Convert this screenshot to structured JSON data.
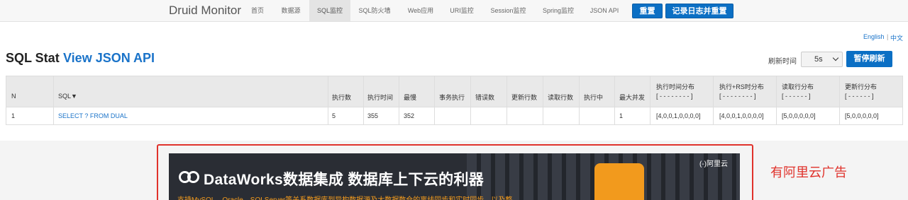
{
  "navbar": {
    "brand": "Druid Monitor",
    "items": [
      {
        "label": "首页",
        "active": false
      },
      {
        "label": "数据源",
        "active": false
      },
      {
        "label": "SQL监控",
        "active": true
      },
      {
        "label": "SQL防火墙",
        "active": false
      },
      {
        "label": "Web应用",
        "active": false
      },
      {
        "label": "URI监控",
        "active": false
      },
      {
        "label": "Session监控",
        "active": false
      },
      {
        "label": "Spring监控",
        "active": false
      },
      {
        "label": "JSON API",
        "active": false
      }
    ],
    "reset_button": "重置",
    "log_reset_button": "记录日志并重置"
  },
  "language": {
    "english": "English",
    "separator": "|",
    "chinese": "中文"
  },
  "heading": {
    "title": "SQL Stat",
    "json_link": "View JSON API"
  },
  "refresh": {
    "label": "刷新时间",
    "selected": "5s",
    "pause_button": "暂停刷新"
  },
  "table": {
    "headers": {
      "n": "N",
      "sql": "SQL▼",
      "exec_count": "执行数",
      "exec_time": "执行时间",
      "slowest": "最慢",
      "txn_exec": "事务执行",
      "errors": "错误数",
      "update_rows": "更新行数",
      "read_rows": "读取行数",
      "running": "执行中",
      "max_concurrent": "最大并发",
      "exec_time_dist": "执行时间分布",
      "exec_time_dist_sub": "[ - - - - - - - - ]",
      "exec_rs_dist": "执行+RS时分布",
      "exec_rs_dist_sub": "[ - - - - - - - - ]",
      "read_rows_dist": "读取行分布",
      "read_rows_dist_sub": "[ - - - - - - ]",
      "update_rows_dist": "更新行分布",
      "update_rows_dist_sub": "[ - - - - - - ]"
    },
    "rows": [
      {
        "n": "1",
        "sql": "SELECT ? FROM DUAL",
        "exec_count": "5",
        "exec_time": "355",
        "slowest": "352",
        "txn_exec": "",
        "errors": "",
        "update_rows": "",
        "read_rows": "",
        "running": "",
        "max_concurrent": "1",
        "exec_time_dist": "[4,0,0,1,0,0,0,0]",
        "exec_rs_dist": "[4,0,0,1,0,0,0,0]",
        "read_rows_dist": "[5,0,0,0,0,0]",
        "update_rows_dist": "[5,0,0,0,0,0]"
      }
    ]
  },
  "ad": {
    "banner_title": "DataWorks数据集成 数据库上下云的利器",
    "banner_subtitle": "支持MySQL、Oracle、SQLServer等关系数据库到异构数据源及大数据数仓的离线同步和实时同步，以及整",
    "banner_badge": "(-)阿里云",
    "note": "有阿里云广告",
    "colors": {
      "frame": "#e0322b",
      "accent": "#f29a1d",
      "banner_bg": "#2a2d34"
    }
  },
  "colors": {
    "primary": "#0b6fc4",
    "link": "#1a73c9"
  }
}
